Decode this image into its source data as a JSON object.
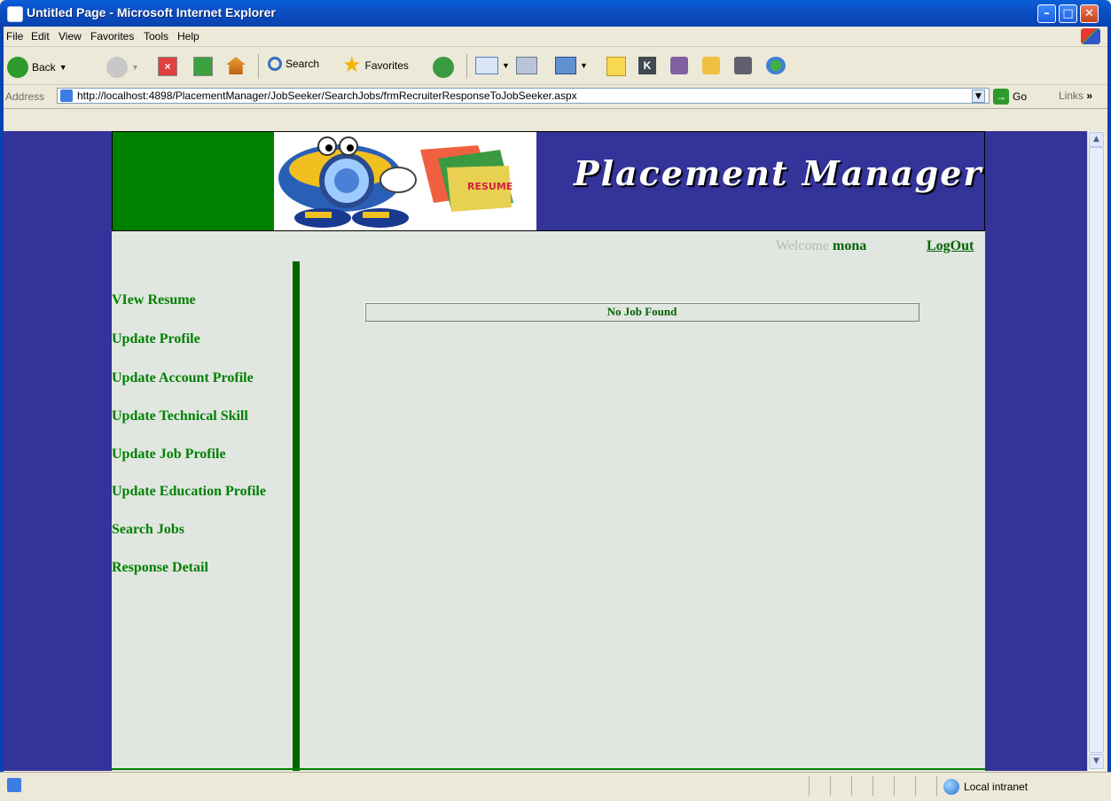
{
  "window": {
    "title": "Untitled Page - Microsoft Internet Explorer",
    "controls": {
      "minimize": "–",
      "maximize": "□",
      "close": "✕"
    }
  },
  "menu": [
    "File",
    "Edit",
    "View",
    "Favorites",
    "Tools",
    "Help"
  ],
  "toolbar": {
    "back": "Back",
    "search": "Search",
    "favorites": "Favorites"
  },
  "address": {
    "label": "Address",
    "url": "http://localhost:4898/PlacementManager/JobSeeker/SearchJobs/frmRecruiterResponseToJobSeeker.aspx",
    "go": "Go",
    "links": "Links"
  },
  "page": {
    "header_title": "Placement Manager",
    "welcome_label": "Welcome",
    "username": "mona",
    "logout": "LogOut",
    "nav": [
      "VIew Resume",
      "Update Profile",
      "Update Account Profile",
      "Update Technical Skill",
      "Update Job Profile",
      "Update Education Profile",
      "Search Jobs",
      "Response Detail"
    ],
    "message": "No Job Found"
  },
  "status": {
    "zone": "Local intranet"
  },
  "colors": {
    "page_bg": "#333399",
    "nav_green": "#008000",
    "content_bg": "#e1e6e1"
  }
}
